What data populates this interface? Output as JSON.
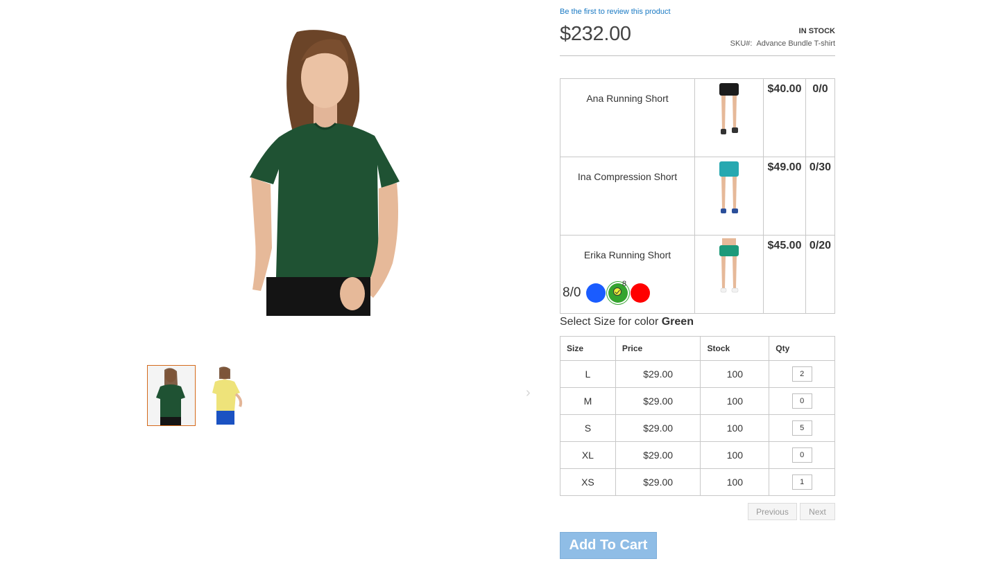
{
  "product": {
    "review_link": "Be the first to review this product",
    "price": "$232.00",
    "stock_status": "IN STOCK",
    "sku_label": "SKU#:",
    "sku_value": "Advance Bundle T-shirt"
  },
  "bundle_items": [
    {
      "name": "Ana Running Short",
      "price": "$40.00",
      "qty": "0/0",
      "image": "black-shorts"
    },
    {
      "name": "Ina Compression Short",
      "price": "$49.00",
      "qty": "0/30",
      "image": "teal-shorts"
    },
    {
      "name": "Erika Running Short",
      "price": "$45.00",
      "qty": "0/20",
      "image": "green-shorts"
    }
  ],
  "swatches": {
    "count": "8/0",
    "badge": "8",
    "options": [
      {
        "color": "#1a5cff",
        "name": "Blue"
      },
      {
        "color": "#35a42f",
        "name": "Green",
        "selected": true
      },
      {
        "color": "#ff0000",
        "name": "Red"
      }
    ]
  },
  "size_heading": {
    "prefix": "Select Size for color",
    "color_name": "Green"
  },
  "size_table": {
    "headers": [
      "Size",
      "Price",
      "Stock",
      "Qty"
    ],
    "rows": [
      {
        "size": "L",
        "price": "$29.00",
        "stock": "100",
        "qty": "2"
      },
      {
        "size": "M",
        "price": "$29.00",
        "stock": "100",
        "qty": "0"
      },
      {
        "size": "S",
        "price": "$29.00",
        "stock": "100",
        "qty": "5"
      },
      {
        "size": "XL",
        "price": "$29.00",
        "stock": "100",
        "qty": "0"
      },
      {
        "size": "XS",
        "price": "$29.00",
        "stock": "100",
        "qty": "1"
      }
    ]
  },
  "pager": {
    "previous": "Previous",
    "next": "Next"
  },
  "add_to_cart": "Add To Cart",
  "gallery": {
    "next_arrow": "›",
    "main_image": "green-tshirt-model",
    "thumbnails": [
      "green-tshirt-model",
      "yellow-tshirt-model"
    ]
  }
}
